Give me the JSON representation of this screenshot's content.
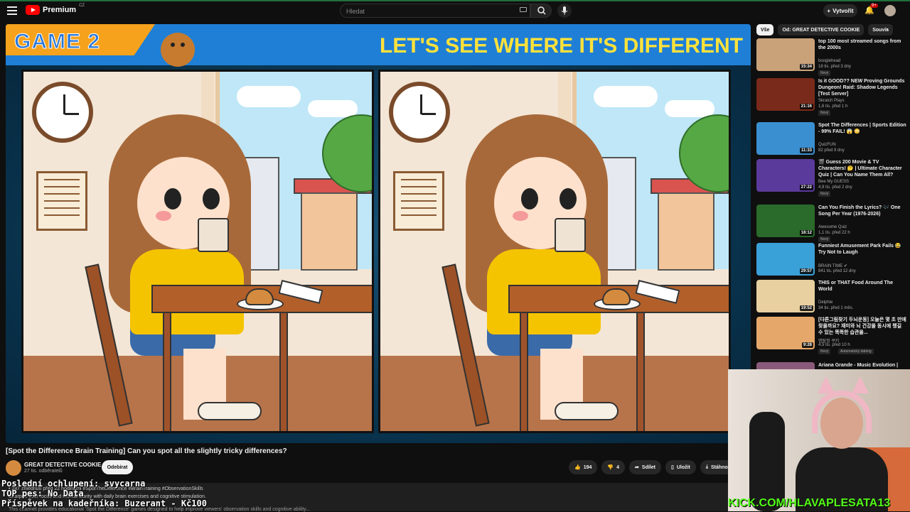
{
  "header": {
    "logo": "Premium",
    "region": "CZ",
    "search_placeholder": "Hledat",
    "create_label": "Vytvořit",
    "notif_count": "9+"
  },
  "video": {
    "game_label": "GAME 2",
    "headline": "LET'S SEE WHERE IT'S DIFFERENT",
    "title": "[Spot the Difference Brain Training] Can you spot all the slightly tricky differences?",
    "channel": "GREAT DETECTIVE COOKIE",
    "subscribers": "27 tis. odběratelů",
    "subscribe_label": "Odebírat",
    "likes": "194",
    "dislikes": "4",
    "share_label": "Sdílet",
    "save_label": "Uložit",
    "download_label": "Stáhnout",
    "desc_meta": "• 287 zhlédnutí před 22 hodinami #SpotTheDifference #BrainTraining #ObservationSkills",
    "desc_line2": "Sharpen your focus and mental clarity with daily brain exercises and cognitive stimulation.",
    "desc_line3": "This channel provides educational 'Spot the Difference' games designed to help improve viewers' observation skills and cognitive ability..."
  },
  "overlay": {
    "line1": "Poslední ochlupení: svycarna",
    "line2": "TOP pes: No Data",
    "line3": "Příspěvek na kadeřníka: Buzerant - Kč100",
    "kick": "KICK.COM/HLAVAPLESATA13"
  },
  "sidebar": {
    "chips": [
      "Vše",
      "Od: GREAT DETECTIVE COOKIE",
      "Souvis"
    ],
    "recs": [
      {
        "title": "top 100 most streamed songs from the 2000s",
        "channel": "booglehead",
        "meta": "18 tis. před 3 dny",
        "duration": "15:34",
        "new": "Nový",
        "color": "#c9a27a"
      },
      {
        "title": "Is it GOOD?? NEW Proving Grounds Dungeon! Raid: Shadow Legends [Test Server]",
        "channel": "Skratch Plays",
        "meta": "1,6 tis. před 1 h",
        "duration": "21:16",
        "new": "Nový",
        "color": "#7a2a1a"
      },
      {
        "title": "Spot The Differences | Sports Edition - 99% FAIL! 😱 😳",
        "channel": "QuizFUN",
        "meta": "82 před 9 dny",
        "duration": "11:33",
        "new": "",
        "color": "#3a8fd0"
      },
      {
        "title": "🎬 Guess 200 Movie & TV Characters! 🤔 | Ultimate Character Quiz | Can You Name Them All?",
        "channel": "Bee My GUESS",
        "meta": "4,9 tis. před 2 dny",
        "duration": "27:22",
        "new": "Nový",
        "color": "#5a3a9a"
      },
      {
        "title": "Can You Finish the Lyrics? 🎶 One Song Per Year (1976-2026)",
        "channel": "Awesome Quiz",
        "meta": "1,1 tis. před 22 h",
        "duration": "18:12",
        "new": "Nový",
        "color": "#2a6a2a"
      },
      {
        "title": "Funniest Amusement Park Fails 😂 Try Not to Laugh",
        "channel": "BRAIN TIME ✔",
        "meta": "841 tis. před 12 dny",
        "duration": "29:57",
        "new": "",
        "color": "#3aa0d8"
      },
      {
        "title": "THIS or THAT Food Around The World",
        "channel": "Delphie",
        "meta": "34 tis. před 1 měs.",
        "duration": "19:52",
        "new": "",
        "color": "#e8d0a0"
      },
      {
        "title": "[다른그림찾기 두뇌운동] 오늘은 몇 초 만에 찾을까요? 재미와 뇌 건강을 동시에 챙길 수 있는 똑똑한 습관을...",
        "channel": "명탐정 쿠키",
        "meta": "4,5 tis. před 10 h",
        "duration": "9:28",
        "new": "Nový",
        "color": "#e6a86a"
      },
      {
        "title": "Ariana Grande - Music Evolution |",
        "channel": "",
        "meta": "",
        "duration": "",
        "new": "",
        "color": "#8a5a7a"
      }
    ],
    "auto_dub": "Automatický dabing"
  },
  "colors": {
    "accent": "#ff0000",
    "kick_green": "#53fc18",
    "banner_blue": "#1f7fd6",
    "headline_yellow": "#ffe23a"
  }
}
